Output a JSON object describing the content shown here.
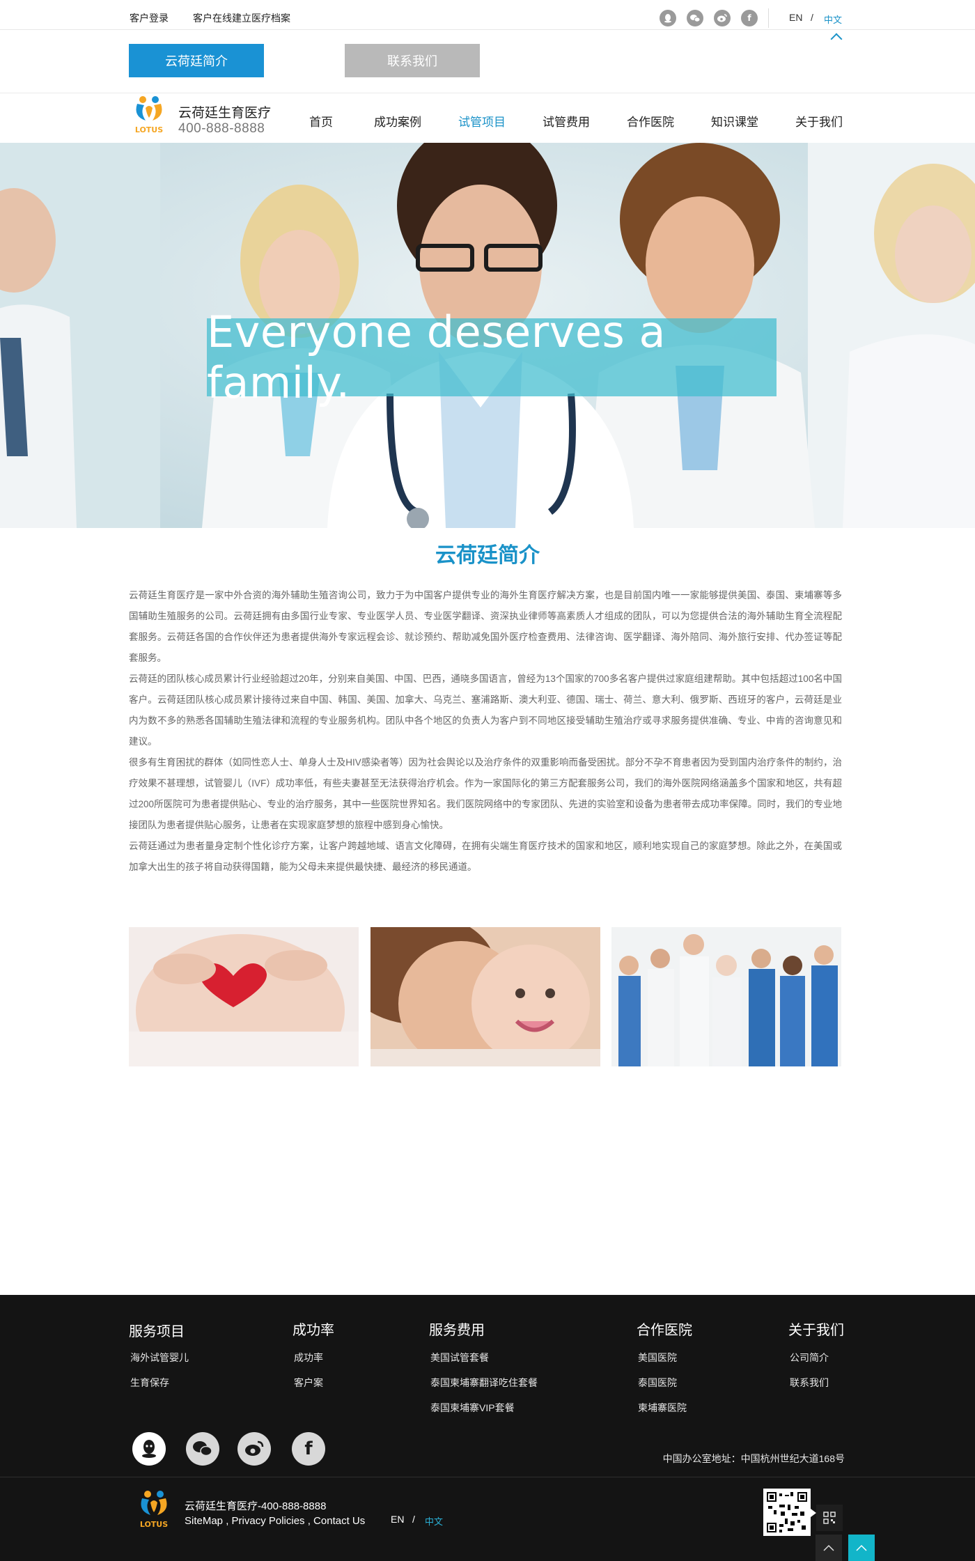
{
  "topbar": {
    "login": "客户登录",
    "archive": "客户在线建立医疗档案",
    "social_icons": [
      "qq-icon",
      "wechat-icon",
      "weibo-icon",
      "facebook-icon"
    ],
    "lang_en": "EN",
    "lang_sep": "/",
    "lang_zh": "中文"
  },
  "tabs": {
    "active": "云荷廷简介",
    "contact": "联系我们"
  },
  "header": {
    "brand_name": "云荷廷生育医疗",
    "phone": "400-888-8888",
    "logo_text": "LOTUS"
  },
  "nav": [
    {
      "label": "首页"
    },
    {
      "label": "成功案例"
    },
    {
      "label": "试管项目",
      "active": true
    },
    {
      "label": "试管费用"
    },
    {
      "label": "合作医院"
    },
    {
      "label": "知识课堂"
    },
    {
      "label": "关于我们"
    }
  ],
  "hero": {
    "tagline": "Everyone deserves a family."
  },
  "intro": {
    "title": "云荷廷简介",
    "paragraphs": [
      "云荷廷生育医疗是一家中外合资的海外辅助生殖咨询公司，致力于为中国客户提供专业的海外生育医疗解决方案，也是目前国内唯一一家能够提供美国、泰国、柬埔寨等多国辅助生殖服务的公司。云荷廷拥有由多国行业专家、专业医学人员、专业医学翻译、资深执业律师等高素质人才组成的团队，可以为您提供合法的海外辅助生育全流程配套服务。云荷廷各国的合作伙伴还为患者提供海外专家远程会诊、就诊预约、帮助减免国外医疗检查费用、法律咨询、医学翻译、海外陪同、海外旅行安排、代办签证等配套服务。",
      "云荷廷的团队核心成员累计行业经验超过20年，分别来自美国、中国、巴西，通晓多国语言，曾经为13个国家的700多名客户提供过家庭组建帮助。其中包括超过100名中国客户。云荷廷团队核心成员累计接待过来自中国、韩国、美国、加拿大、乌克兰、塞浦路斯、澳大利亚、德国、瑞士、荷兰、意大利、俄罗斯、西班牙的客户，云荷廷是业内为数不多的熟悉各国辅助生殖法律和流程的专业服务机构。团队中各个地区的负责人为客户到不同地区接受辅助生殖治疗或寻求服务提供准确、专业、中肯的咨询意见和建议。",
      "很多有生育困扰的群体（如同性恋人士、单身人士及HIV感染者等）因为社会舆论以及治疗条件的双重影响而备受困扰。部分不孕不育患者因为受到国内治疗条件的制约，治疗效果不甚理想，试管婴儿（IVF）成功率低，有些夫妻甚至无法获得治疗机会。作为一家国际化的第三方配套服务公司，我们的海外医院网络涵盖多个国家和地区，共有超过200所医院可为患者提供贴心、专业的治疗服务，其中一些医院世界知名。我们医院网络中的专家团队、先进的实验室和设备为患者带去成功率保障。同时，我们的专业地接团队为患者提供贴心服务，让患者在实现家庭梦想的旅程中感到身心愉快。",
      "云荷廷通过为患者量身定制个性化诊疗方案，让客户跨越地域、语言文化障碍，在拥有尖端生育医疗技术的国家和地区，顺利地实现自己的家庭梦想。除此之外，在美国或加拿大出生的孩子将自动获得国籍，能为父母未来提供最快捷、最经济的移民通道。"
    ]
  },
  "footer": {
    "columns": [
      {
        "title": "服务项目",
        "items": [
          "海外试管婴儿",
          "生育保存"
        ]
      },
      {
        "title": "成功率",
        "items": [
          "成功率",
          "客户案"
        ]
      },
      {
        "title": "服务费用",
        "items": [
          "美国试管套餐",
          "泰国柬埔寨翻译吃住套餐",
          "泰国柬埔寨VIP套餐"
        ]
      },
      {
        "title": "合作医院",
        "items": [
          "美国医院",
          "泰国医院",
          "柬埔寨医院"
        ]
      },
      {
        "title": "关于我们",
        "items": [
          "公司简介",
          "联系我们"
        ]
      }
    ],
    "social_icons": [
      "qq-icon",
      "wechat-icon",
      "weibo-icon",
      "facebook-icon"
    ],
    "address": "中国办公室地址：中国杭州世纪大道168号",
    "brand_line": "云荷廷生育医疗-400-888-8888",
    "links": "SiteMap ,  Privacy Policies , Contact Us",
    "lang_en": "EN",
    "lang_sep": "/",
    "lang_zh": "中文",
    "logo_text": "LOTUS"
  },
  "colors": {
    "accent": "#1a92c8",
    "footer_bg": "#141414",
    "hero_banner": "#40bcce",
    "totop": "#12b5c9"
  }
}
